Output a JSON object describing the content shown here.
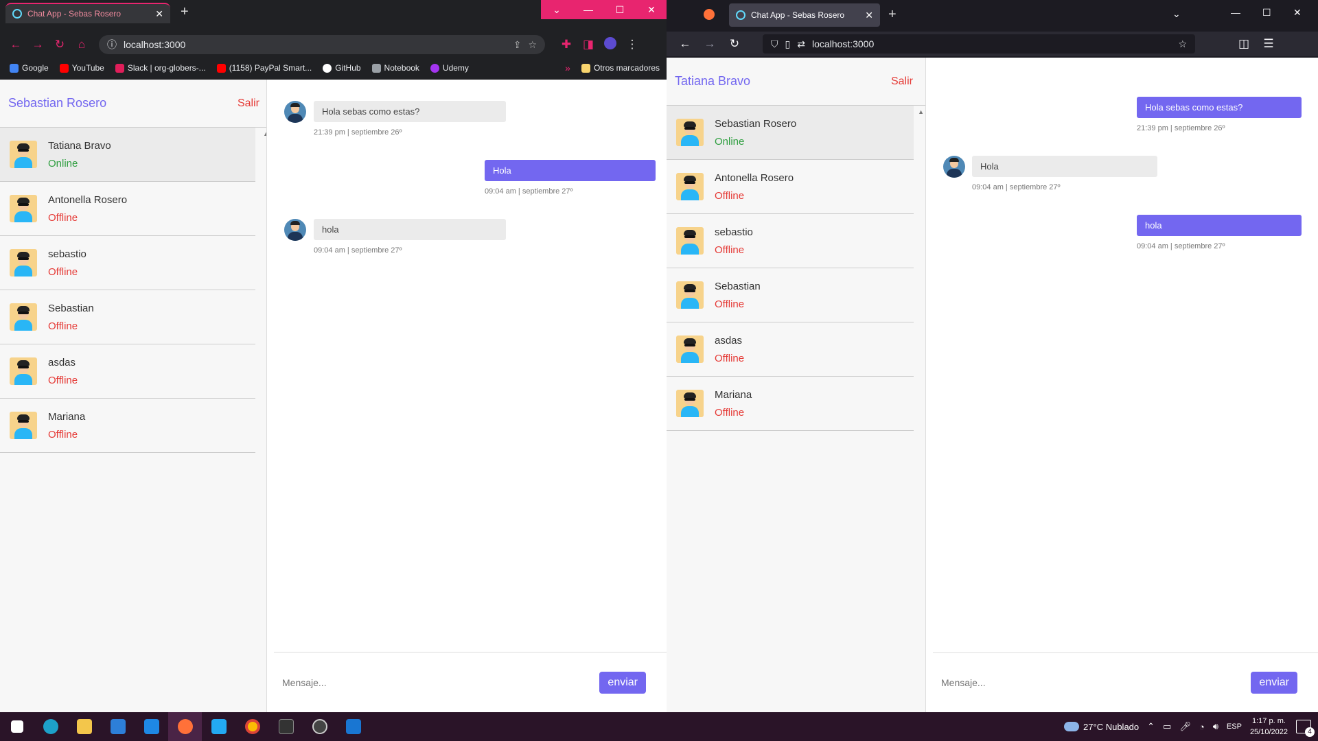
{
  "chrome": {
    "tab_title": "Chat App - Sebas Rosero",
    "url": "localhost:3000",
    "bookmarks": [
      {
        "label": "Google",
        "color": "#4285f4"
      },
      {
        "label": "YouTube",
        "color": "#ff0000"
      },
      {
        "label": "Slack | org-globers-...",
        "color": "#e01e5a"
      },
      {
        "label": "(1158) PayPal Smart...",
        "color": "#ff0000"
      },
      {
        "label": "GitHub",
        "color": "#ffffff"
      },
      {
        "label": "Notebook",
        "color": "#9aa0a6"
      },
      {
        "label": "Udemy",
        "color": "#a435f0"
      }
    ],
    "bookmarks_overflow": "»",
    "other_bookmarks": "Otros marcadores",
    "app": {
      "current_user": "Sebastian Rosero",
      "logout": "Salir",
      "users": [
        {
          "name": "Tatiana Bravo",
          "status": "Online"
        },
        {
          "name": "Antonella Rosero",
          "status": "Offline"
        },
        {
          "name": "sebastio",
          "status": "Offline"
        },
        {
          "name": "Sebastian",
          "status": "Offline"
        },
        {
          "name": "asdas",
          "status": "Offline"
        },
        {
          "name": "Mariana",
          "status": "Offline"
        }
      ],
      "messages": [
        {
          "dir": "in",
          "text": "Hola sebas como estas?",
          "time": "21:39 pm | septiembre 26º"
        },
        {
          "dir": "out",
          "text": "Hola",
          "time": "09:04 am | septiembre 27º"
        },
        {
          "dir": "in",
          "text": "hola",
          "time": "09:04 am | septiembre 27º"
        }
      ],
      "placeholder": "Mensaje...",
      "send": "enviar"
    }
  },
  "firefox": {
    "tab_title": "Chat App - Sebas Rosero",
    "url": "localhost:3000",
    "app": {
      "current_user": "Tatiana Bravo",
      "logout": "Salir",
      "users": [
        {
          "name": "Sebastian Rosero",
          "status": "Online"
        },
        {
          "name": "Antonella Rosero",
          "status": "Offline"
        },
        {
          "name": "sebastio",
          "status": "Offline"
        },
        {
          "name": "Sebastian",
          "status": "Offline"
        },
        {
          "name": "asdas",
          "status": "Offline"
        },
        {
          "name": "Mariana",
          "status": "Offline"
        }
      ],
      "messages": [
        {
          "dir": "out",
          "text": "Hola sebas como estas?",
          "time": "21:39 pm | septiembre 26º"
        },
        {
          "dir": "in",
          "text": "Hola",
          "time": "09:04 am | septiembre 27º"
        },
        {
          "dir": "out",
          "text": "hola",
          "time": "09:04 am | septiembre 27º"
        }
      ],
      "placeholder": "Mensaje...",
      "send": "enviar"
    }
  },
  "taskbar": {
    "weather": "27°C  Nublado",
    "language": "ESP",
    "time": "1:17 p. m.",
    "date": "25/10/2022",
    "notifications": "4",
    "apps": [
      "windows-start",
      "edge",
      "file-explorer",
      "store",
      "mail",
      "firefox",
      "vscode",
      "chrome",
      "terminal",
      "obs",
      "app"
    ]
  }
}
